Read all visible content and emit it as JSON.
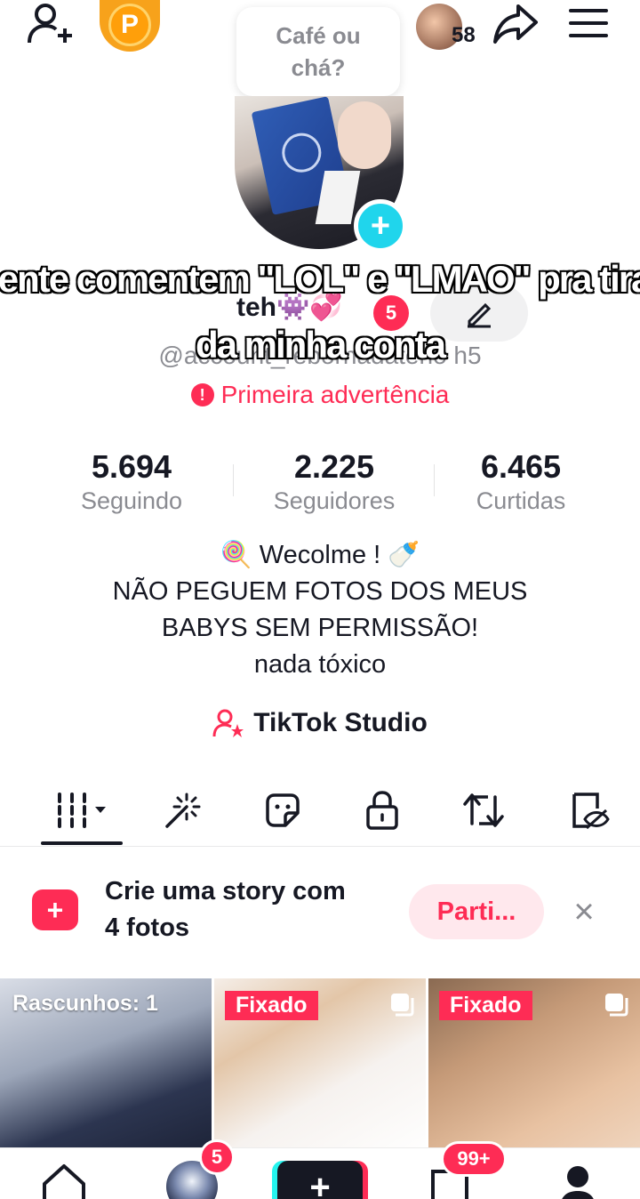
{
  "top_bar": {
    "coin_label": "P",
    "bubble_text": "Café ou chá?",
    "friends_count": "58"
  },
  "profile": {
    "name": "teh👾💞",
    "name_badge": "5",
    "handle": "@account_rebornadateho h5",
    "warning": "Primeira advertência",
    "overlay_line1": "gente comentem \"LOL\" e \"LMAO\" pra tirar",
    "overlay_line2": "da minha conta"
  },
  "stats": [
    {
      "value": "5.694",
      "label": "Seguindo"
    },
    {
      "value": "2.225",
      "label": "Seguidores"
    },
    {
      "value": "6.465",
      "label": "Curtidas"
    }
  ],
  "bio": {
    "line1": "🍭 Wecolme ! 🍼",
    "line2": "NÃO PEGUEM FOTOS DOS MEUS",
    "line3": "BABYS SEM PERMISSÃO!",
    "line4": "nada tóxico"
  },
  "studio_label": "TikTok Studio",
  "story_prompt": {
    "line1": "Crie uma story com",
    "line2": "4 fotos",
    "button_label": "Parti...",
    "close_symbol": "×"
  },
  "grid": {
    "drafts_label": "Rascunhos: 1",
    "pinned_label": "Fixado",
    "pinned_label_2": "Fixado"
  },
  "bottom_nav": {
    "inbox_badge": "99+",
    "friends_badge": "5",
    "create_symbol": "+"
  },
  "colors": {
    "accent": "#fe2c55",
    "cyan": "#20d5ec",
    "muted": "#8a8b91",
    "coin": "#f7a21b"
  }
}
